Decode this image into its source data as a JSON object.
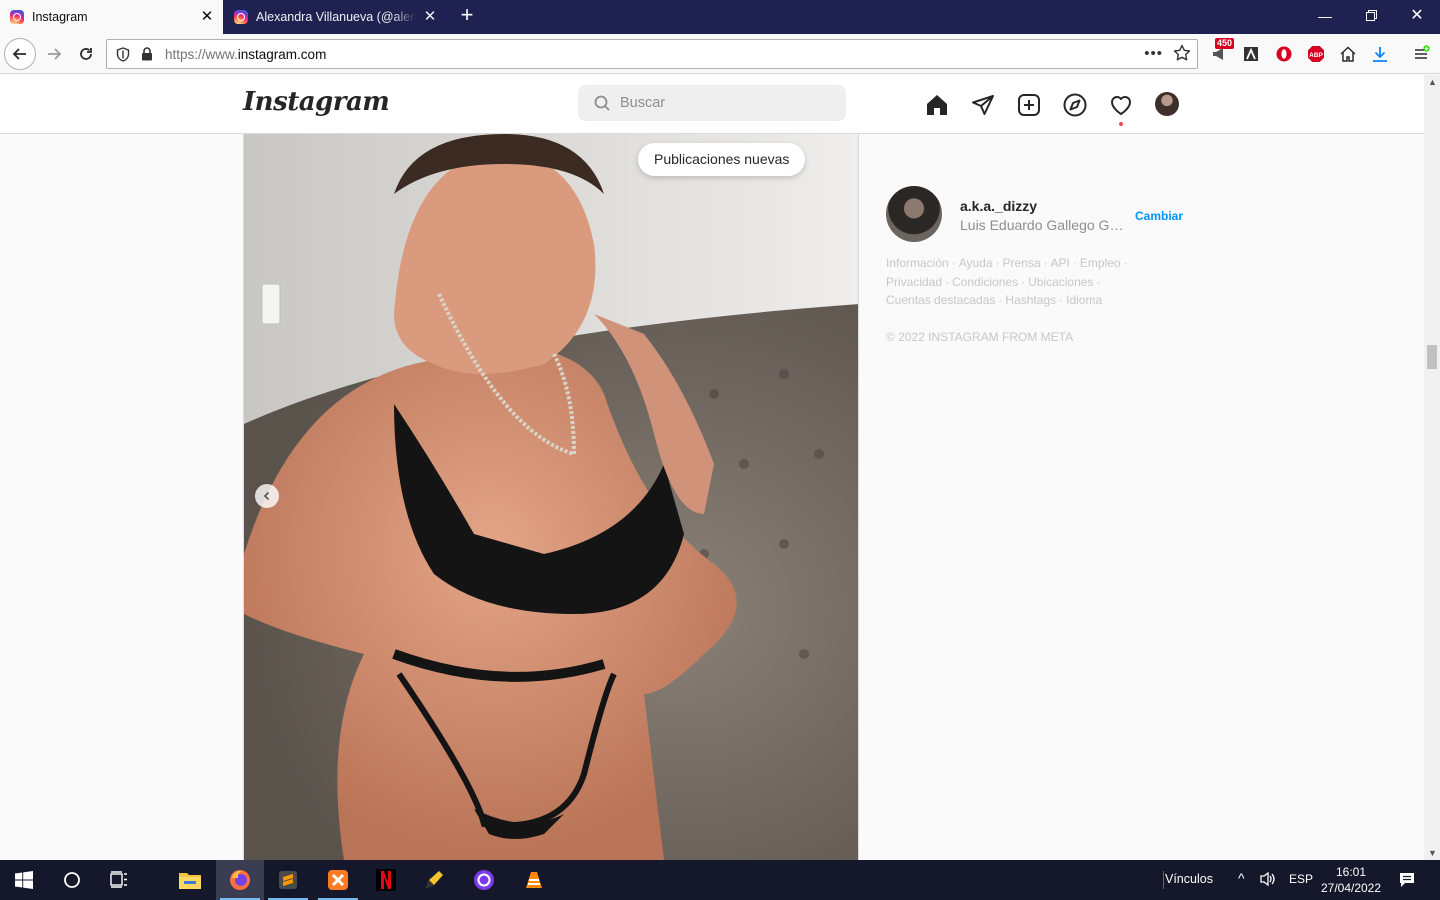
{
  "browser": {
    "tabs": [
      {
        "title": "Instagram",
        "active": true
      },
      {
        "title": "Alexandra Villanueva (@alemiz",
        "active": false
      }
    ],
    "url_scheme": "https://www.",
    "url_host": "instagram.com",
    "extensions_badge": "450"
  },
  "instagram": {
    "logo": "Instagram",
    "search_placeholder": "Buscar",
    "nav_icons": [
      "home-icon",
      "direct-icon",
      "new-post-icon",
      "explore-icon",
      "activity-icon",
      "profile-avatar"
    ],
    "new_posts_button": "Publicaciones nuevas",
    "sidebar": {
      "username": "a.k.a._dizzy",
      "full_name": "Luis Eduardo Gallego Gar...",
      "switch_label": "Cambiar",
      "footer_links": [
        "Información",
        "Ayuda",
        "Prensa",
        "API",
        "Empleo",
        "Privacidad",
        "Condiciones",
        "Ubicaciones",
        "Cuentas destacadas",
        "Hashtags",
        "Idioma"
      ],
      "copyright": "© 2022 INSTAGRAM FROM META"
    }
  },
  "taskbar": {
    "apps": [
      "start",
      "search",
      "task-view",
      "file-explorer",
      "firefox",
      "sublime-text",
      "xampp",
      "netflix",
      "tool",
      "github",
      "vlc"
    ],
    "links_label": "Vínculos",
    "language": "ESP",
    "time": "16:01",
    "date": "27/04/2022"
  },
  "colors": {
    "tabbar": "#1f2150",
    "link_blue": "#0095f6",
    "taskbar": "#15182a"
  }
}
